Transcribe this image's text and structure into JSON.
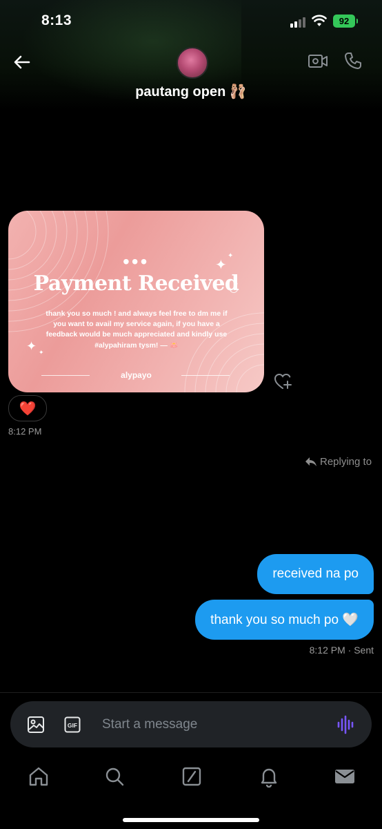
{
  "status_bar": {
    "time": "8:13",
    "battery": "92"
  },
  "header": {
    "title": "pautang open 🩰"
  },
  "media_card": {
    "headline": "Payment Received",
    "body": "thank you so much ! and always feel free to dm me if you want to avail my service again, if you have a feedback would be much appreciated and kindly use #alypahiram tysm! — 🪷",
    "brand": "alypayo"
  },
  "received": {
    "reaction": "❤️",
    "time": "8:12 PM"
  },
  "replying_label": "Replying to",
  "sent": {
    "messages": [
      "received na po",
      "thank you so much po 🤍"
    ],
    "time": "8:12 PM · Sent"
  },
  "composer": {
    "placeholder": "Start a message"
  },
  "icons": {
    "back": "back-arrow-icon",
    "video": "video-call-icon",
    "phone": "phone-call-icon",
    "react": "add-reaction-heart-icon",
    "reply": "reply-arrow-icon",
    "image": "image-icon",
    "gif": "gif-icon",
    "voice": "voice-message-icon",
    "nav": [
      "home-icon",
      "search-icon",
      "grok-icon",
      "notifications-icon",
      "messages-icon"
    ]
  },
  "colors": {
    "accent": "#1d9bf0",
    "voice": "#7856ff",
    "battery": "#34c759"
  }
}
